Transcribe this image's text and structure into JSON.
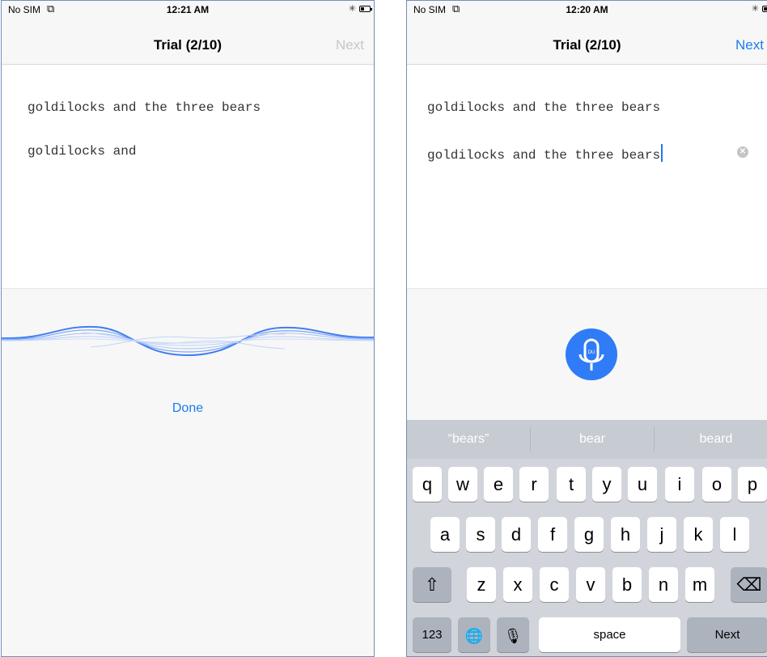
{
  "left_screen": {
    "status": {
      "carrier": "No SIM",
      "time": "12:21 AM"
    },
    "nav": {
      "title": "Trial (2/10)",
      "next_label": "Next"
    },
    "phrase_prompt": "goldilocks and the three bears",
    "typed_text": "goldilocks and",
    "done_label": "Done"
  },
  "right_screen": {
    "status": {
      "carrier": "No SIM",
      "time": "12:20 AM"
    },
    "nav": {
      "title": "Trial (2/10)",
      "next_label": "Next"
    },
    "phrase_prompt": "goldilocks and the three bears",
    "typed_text": "goldilocks and the three bears",
    "mic_badge": "DU",
    "suggestions": [
      "“bears”",
      "bear",
      "beard"
    ],
    "keyboard": {
      "row1": [
        "q",
        "w",
        "e",
        "r",
        "t",
        "y",
        "u",
        "i",
        "o",
        "p"
      ],
      "row2": [
        "a",
        "s",
        "d",
        "f",
        "g",
        "h",
        "j",
        "k",
        "l"
      ],
      "row3": [
        "z",
        "x",
        "c",
        "v",
        "b",
        "n",
        "m"
      ],
      "numbers_label": "123",
      "space_label": "space",
      "return_label": "Next"
    }
  },
  "colors": {
    "accent": "#1a7cf0",
    "mic": "#2f7cf6",
    "keyboard_bg": "#d1d5db"
  }
}
